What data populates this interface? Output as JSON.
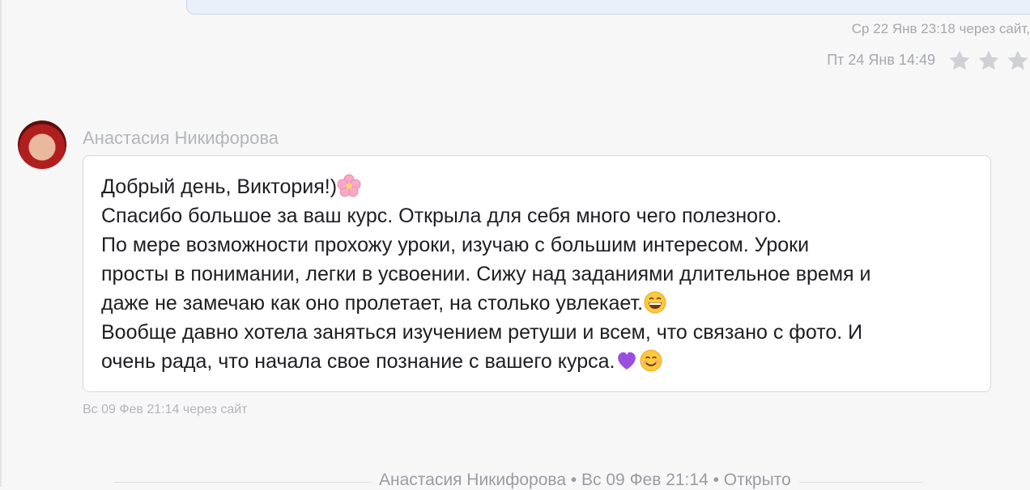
{
  "previous": {
    "meta_sent": "Ср 22 Янв 23:18 через сайт,",
    "meta_read": "Пт 24 Янв 14:49"
  },
  "message": {
    "author": "Анастасия Никифорова",
    "lines": [
      "Добрый день, Виктория!)",
      "Спасибо большое за ваш курс. Открыла для себя много чего полезного.",
      "По мере возможности прохожу уроки, изучаю с большим интересом. Уроки",
      "просты в понимании, легки в усвоении. Сижу над заданиями длительное время и",
      "даже не замечаю как оно пролетает, на столько увлекает.",
      "Вообще давно хотела заняться изучением ретуши и всем, что связано с фото. И",
      "очень рада, что начала свое познание с вашего курса."
    ],
    "meta": "Вс 09 Фев 21:14 через сайт"
  },
  "status": {
    "text": "Анастасия Никифорова • Вс 09 Фев 21:14 • Открыто"
  }
}
